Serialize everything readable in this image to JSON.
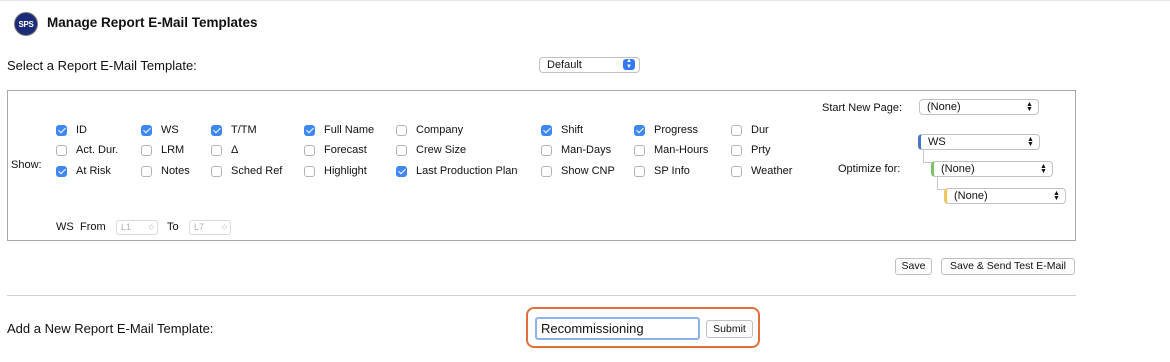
{
  "header": {
    "logo_text": "SPS",
    "title": "Manage Report E-Mail Templates"
  },
  "select_template": {
    "label": "Select a Report E-Mail Template:",
    "value": "Default"
  },
  "panel": {
    "show_label": "Show:",
    "columns": [
      {
        "label": "ID",
        "checked": true
      },
      {
        "label": "WS",
        "checked": true
      },
      {
        "label": "T/TM",
        "checked": true
      },
      {
        "label": "Full Name",
        "checked": true
      },
      {
        "label": "Company",
        "checked": false
      },
      {
        "label": "Shift",
        "checked": true
      },
      {
        "label": "Progress",
        "checked": true
      },
      {
        "label": "Dur",
        "checked": false
      },
      {
        "label": "Act. Dur.",
        "checked": false
      },
      {
        "label": "LRM",
        "checked": false
      },
      {
        "label": "Δ",
        "checked": false
      },
      {
        "label": "Forecast",
        "checked": false
      },
      {
        "label": "Crew Size",
        "checked": false
      },
      {
        "label": "Man-Days",
        "checked": false
      },
      {
        "label": "Man-Hours",
        "checked": false
      },
      {
        "label": "Prty",
        "checked": false
      },
      {
        "label": "At Risk",
        "checked": true
      },
      {
        "label": "Notes",
        "checked": false
      },
      {
        "label": "Sched Ref",
        "checked": false
      },
      {
        "label": "Highlight",
        "checked": false
      },
      {
        "label": "Last Production Plan",
        "checked": true
      },
      {
        "label": "Show CNP",
        "checked": false
      },
      {
        "label": "SP Info",
        "checked": false
      },
      {
        "label": "Weather",
        "checked": false
      }
    ],
    "start_new_page": {
      "label": "Start New Page:",
      "value": "(None)"
    },
    "optimize": {
      "label": "Optimize for:",
      "level1": "WS",
      "level2": "(None)",
      "level3": "(None)"
    },
    "ws_range": {
      "ws_label": "WS",
      "from_label": "From",
      "from_value": "L1",
      "to_label": "To",
      "to_value": "L7"
    }
  },
  "actions": {
    "save": "Save",
    "save_send": "Save & Send Test E-Mail"
  },
  "new_template": {
    "label": "Add a New Report E-Mail Template:",
    "value": "Recommissioning",
    "submit": "Submit"
  },
  "colors": {
    "checkbox": "#3f88f1",
    "logo": "#1b2b78",
    "highlight": "#e06f3a",
    "ws_flag": "#4a74c9",
    "l2_flag": "#7cc36a",
    "l3_flag": "#f0c65a"
  }
}
